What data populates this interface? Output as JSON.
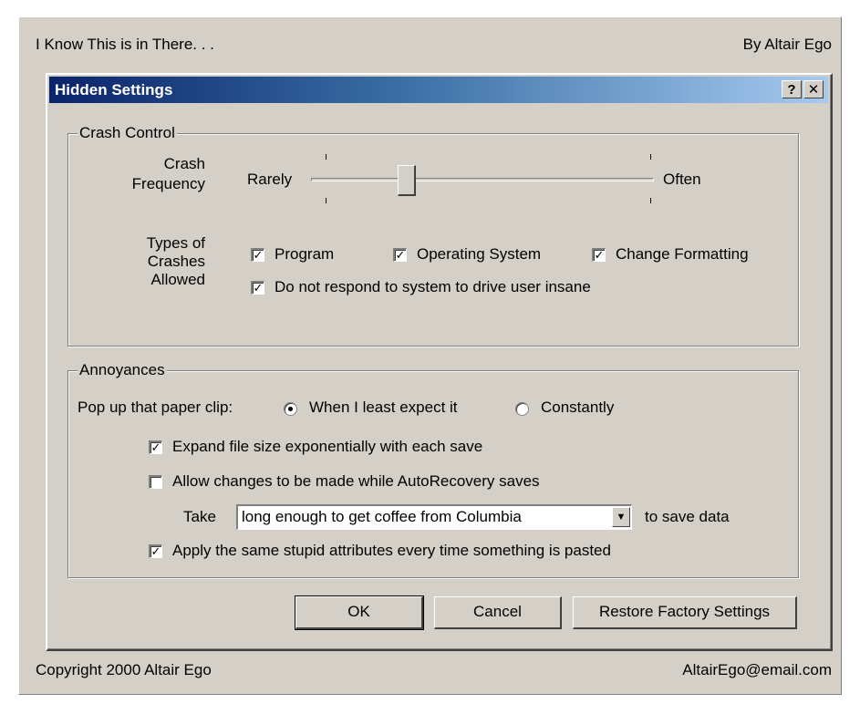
{
  "outer": {
    "title": "I Know This is in There. . .",
    "byline": "By Altair Ego",
    "copyright": "Copyright 2000 Altair Ego",
    "email": "AltairEgo@email.com"
  },
  "dialog": {
    "title": "Hidden Settings",
    "help_button": "?",
    "close_button": "✕"
  },
  "crash_control": {
    "group_label": "Crash Control",
    "frequency_label_line1": "Crash",
    "frequency_label_line2": "Frequency",
    "slider_min_label": "Rarely",
    "slider_max_label": "Often",
    "slider_value_fraction": 0.25,
    "types_label_line1": "Types of",
    "types_label_line2": "Crashes",
    "types_label_line3": "Allowed",
    "checkboxes": [
      {
        "label": "Program",
        "checked": true
      },
      {
        "label": "Operating System",
        "checked": true
      },
      {
        "label": "Change Formatting",
        "checked": true
      },
      {
        "label": "Do not respond to system to drive user insane",
        "checked": true
      }
    ]
  },
  "annoyances": {
    "group_label": "Annoyances",
    "paperclip_label": "Pop up that paper clip:",
    "radio_options": [
      {
        "label": "When I least expect it",
        "selected": true
      },
      {
        "label": "Constantly",
        "selected": false
      }
    ],
    "expand_label": "Expand file size exponentially with each save",
    "expand_checked": true,
    "allow_changes_label": "Allow changes to be made while AutoRecovery saves",
    "allow_changes_checked": false,
    "take_label": "Take",
    "take_value": "long enough to get coffee from Columbia",
    "save_data_label": "to save data",
    "apply_label": "Apply the same stupid attributes every time something is pasted",
    "apply_checked": true
  },
  "buttons": {
    "ok": "OK",
    "cancel": "Cancel",
    "restore": "Restore Factory Settings"
  },
  "check_glyph": "✓",
  "colors": {
    "face": "#d4d0c8",
    "title_start": "#0a246a",
    "title_end": "#a6caf0"
  }
}
